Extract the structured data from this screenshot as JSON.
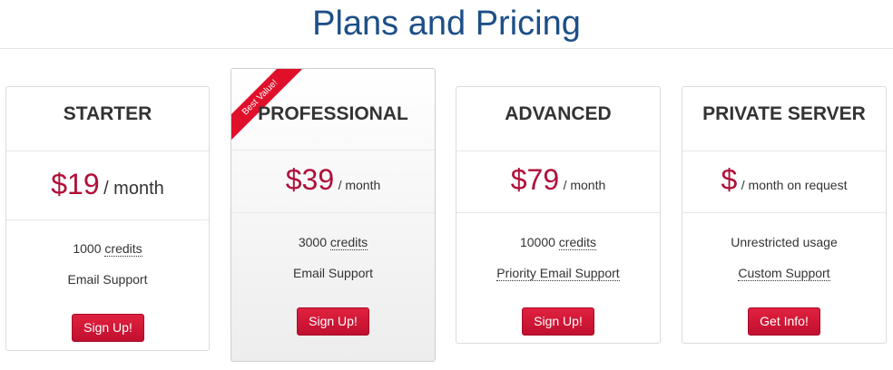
{
  "page": {
    "title": "Plans and Pricing"
  },
  "colors": {
    "title": "#1d4f87",
    "price": "#b0103a",
    "button": "#d3172f",
    "ribbon": "#e0102a"
  },
  "plans": [
    {
      "name": "STARTER",
      "price_symbol": "$19",
      "price_period": "/ month",
      "features": [
        "1000",
        "credits",
        "Email Support"
      ],
      "button": "Sign Up!"
    },
    {
      "name": "PROFESSIONAL",
      "ribbon": "Best Value!",
      "price_symbol": "$39",
      "price_period": "/ month",
      "features": [
        "3000",
        "credits",
        "Email Support"
      ],
      "button": "Sign Up!"
    },
    {
      "name": "ADVANCED",
      "price_symbol": "$79",
      "price_period": "/ month",
      "features": [
        "10000",
        "credits",
        "Priority Email Support"
      ],
      "button": "Sign Up!"
    },
    {
      "name": "PRIVATE SERVER",
      "price_symbol": "$",
      "price_period": "/ month on request",
      "features": [
        "Unrestricted usage",
        "Custom Support"
      ],
      "button": "Get Info!"
    }
  ]
}
